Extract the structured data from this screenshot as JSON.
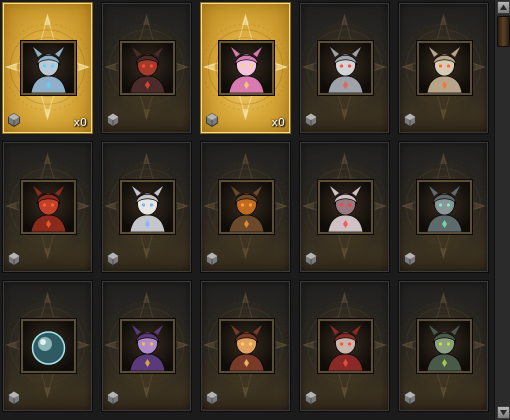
{
  "collection": {
    "cards": [
      {
        "name": "silver-knight-portrait",
        "owned": true,
        "count": "x0",
        "hue": "#8fb0c8",
        "accent": "#b9c9d6",
        "glow": "#5fd0ff"
      },
      {
        "name": "dark-horned-demon-portrait",
        "owned": false,
        "count": "",
        "hue": "#4a2a2a",
        "accent": "#a33a2a",
        "glow": "#ff4a30"
      },
      {
        "name": "pink-winged-girl-portrait",
        "owned": true,
        "count": "x0",
        "hue": "#d77ab0",
        "accent": "#f2c4de",
        "glow": "#ffd36a"
      },
      {
        "name": "silver-haired-wraith-portrait",
        "owned": false,
        "count": "",
        "hue": "#9ea2aa",
        "accent": "#d2d4d8",
        "glow": "#ff5040"
      },
      {
        "name": "bone-spider-portrait",
        "owned": false,
        "count": "",
        "hue": "#b7a58a",
        "accent": "#d8cbb3",
        "glow": "#ff6a3a"
      },
      {
        "name": "red-demon-portrait",
        "owned": false,
        "count": "",
        "hue": "#8a2a1c",
        "accent": "#c0402a",
        "glow": "#ff6030"
      },
      {
        "name": "white-haired-elf-portrait",
        "owned": false,
        "count": "",
        "hue": "#c4c6cc",
        "accent": "#e8e6e2",
        "glow": "#7ab0ff"
      },
      {
        "name": "flame-armored-beast-portrait",
        "owned": false,
        "count": "",
        "hue": "#6a4a2a",
        "accent": "#c06a20",
        "glow": "#ff9a30"
      },
      {
        "name": "pale-spider-woman-portrait",
        "owned": false,
        "count": "",
        "hue": "#d0c2c4",
        "accent": "#9a7880",
        "glow": "#ff4040"
      },
      {
        "name": "stone-golem-portrait",
        "owned": false,
        "count": "",
        "hue": "#5e6a6c",
        "accent": "#8a9698",
        "glow": "#7af0c0"
      },
      {
        "name": "glowing-orb-portrait",
        "owned": false,
        "count": "",
        "hue": "#2f5a62",
        "accent": "#a8e8ee",
        "glow": "#d4ffff"
      },
      {
        "name": "purple-witch-portrait",
        "owned": false,
        "count": "",
        "hue": "#5a3a7a",
        "accent": "#b08ac8",
        "glow": "#f0c040"
      },
      {
        "name": "masked-warrior-portrait",
        "owned": false,
        "count": "",
        "hue": "#7a3a2a",
        "accent": "#e0a060",
        "glow": "#ffd060"
      },
      {
        "name": "red-haired-succubus-portrait",
        "owned": false,
        "count": "",
        "hue": "#8a2a26",
        "accent": "#c8b4a8",
        "glow": "#ff5040"
      },
      {
        "name": "scaled-lizard-portrait",
        "owned": false,
        "count": "",
        "hue": "#4a5a4a",
        "accent": "#8aa080",
        "glow": "#c0e040"
      }
    ]
  },
  "colors": {
    "owned_card": "#d8a83a",
    "locked_card": "#2e2a22",
    "scroll_thumb": "#5b4026"
  },
  "scrollbar": {
    "up_icon": "arrow-up-icon",
    "down_icon": "arrow-down-icon"
  }
}
